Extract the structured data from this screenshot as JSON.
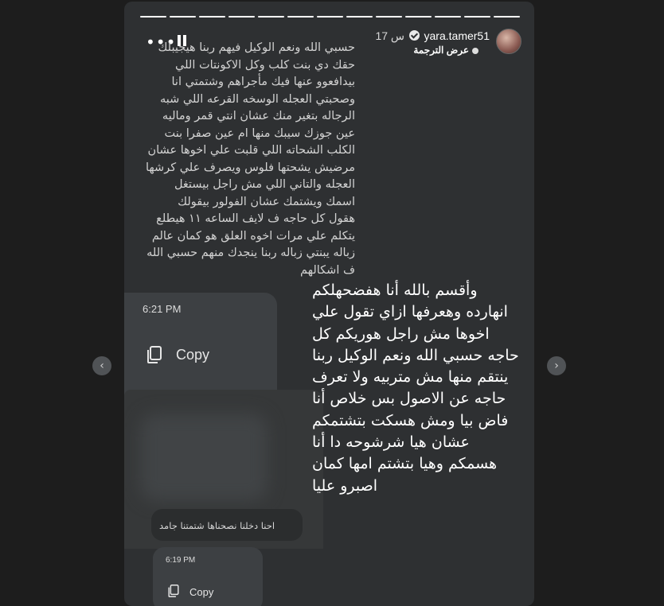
{
  "header": {
    "username": "yara.tamer51",
    "time": "17 س",
    "translate_label": "عرض الترجمة",
    "more": "•••"
  },
  "progress": {
    "total_segments": 13,
    "current_segment": 12
  },
  "screenshot": {
    "text": "حسبي الله ونعم الوكيل فيهم ربنا هيجيبلك\nحقك دي بنت كلب وكل الاكونتات اللي\nبيدافعوو عنها فيك مأجراهم وشتمتي انا\nوصحبتي العجله الوسخه القرعه اللي شبه\nالرجاله بتغير منك عشان انتي قمر وماليه\nعين جوزك سيبك منها ام عين صفرا بنت\nالكلب الشحاته اللي قلبت علي اخوها عشان\nمرضيش يشحتها فلوس ويصرف علي كرشها\nالعجله والتاني اللي مش راجل بيستغل\nاسمك ويشتمك عشان الفولور بيقولك\nهقول كل حاجه ف لايف الساعه ١١ هيطلع\nيتكلم علي مرات اخوه العلق هو كمان عالم\nزباله يبنتي زباله ربنا ينجدك منهم حسبي الله\nف اشكالهم",
    "copy_time": "6:21 PM",
    "copy_label": "Copy",
    "chat_text": "احنا دخلنا نصحناها شتمتنا جامد",
    "copy2_time": "6:19 PM",
    "copy2_label": "Copy"
  },
  "caption": "وأقسم بالله أنا هفضحهلكم\nانهارده وهعرفها ازاي تقول علي\nاخوها مش راجل هوريكم كل\nحاجه حسبي الله ونعم الوكيل ربنا\nينتقم منها مش متربيه ولا تعرف\nحاجه عن الاصول بس خلاص أنا\nفاض بيا ومش هسكت بتشتمكم\nعشان هيا شرشوحه دا أنا\nهسمكم وهيا بتشتم امها كمان\nاصبرو عليا",
  "nav": {
    "prev": "‹",
    "next": "›"
  },
  "colors": {
    "background": "#1d1d1d",
    "story_bg": "#2e3032",
    "card": "#3d4043",
    "text": "#ffffff"
  }
}
